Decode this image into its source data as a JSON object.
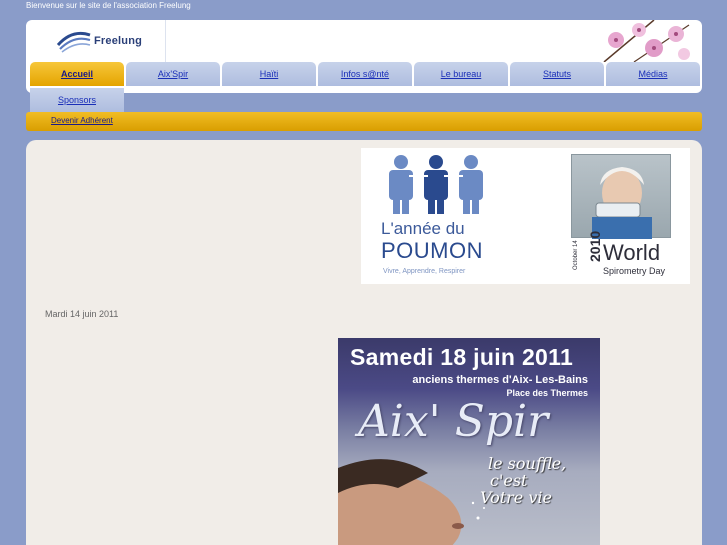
{
  "header": {
    "welcome": "Bienvenue sur le site de l'association Freelung",
    "logo_text": "Freelung"
  },
  "nav": {
    "tabs": [
      {
        "label": "Accueil",
        "active": true
      },
      {
        "label": "Aix'Spir",
        "active": false
      },
      {
        "label": "Haïti",
        "active": false
      },
      {
        "label": "Infos s@nté",
        "active": false
      },
      {
        "label": "Le bureau",
        "active": false
      },
      {
        "label": "Statuts",
        "active": false
      },
      {
        "label": "Médias",
        "active": false
      }
    ],
    "second_row": {
      "label": "Sponsors"
    },
    "submenu_link": "Devenir Adhérent"
  },
  "banner": {
    "title_line1": "L'année du",
    "title_line2": "POUMON",
    "tagline": "Vivre, Apprendre, Respirer",
    "world_oct": "October 14",
    "world_year": "2010",
    "world_title": "World",
    "world_subtitle": "Spirometry Day"
  },
  "article": {
    "date": "Mardi 14 juin 2011"
  },
  "poster": {
    "date": "Samedi  18 juin 2011",
    "venue": "anciens thermes d'Aix- Les-Bains",
    "place": "Place des Thermes",
    "name": "Aix' Spir",
    "slogan_line1": "le souffle,",
    "slogan_line2": "c'est",
    "slogan_line3": "Votre vie"
  },
  "colors": {
    "background": "#8a9cc9",
    "accent": "#f1bd25",
    "tab": "#c7d2ea",
    "link": "#1a2fb8"
  }
}
